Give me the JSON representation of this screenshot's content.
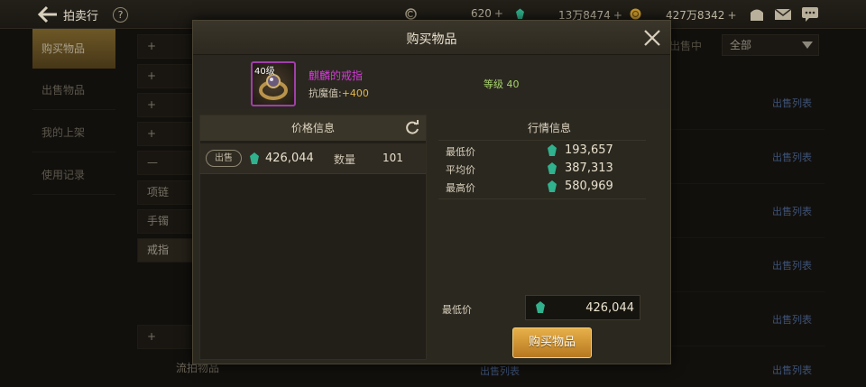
{
  "topbar": {
    "title": "拍卖行",
    "help_label": "?",
    "currency1": "620",
    "currency2": "13万8474",
    "currency3": "427万8342",
    "plus": "+"
  },
  "sidebar": {
    "items": [
      {
        "label": "购买物品"
      },
      {
        "label": "出售物品"
      },
      {
        "label": "我的上架"
      },
      {
        "label": "使用记录"
      }
    ]
  },
  "categories": {
    "rows": [
      {
        "label": "+"
      },
      {
        "label": "+"
      },
      {
        "label": "+"
      },
      {
        "label": "+"
      },
      {
        "label": "—"
      },
      {
        "label": "项链"
      },
      {
        "label": "手镯"
      },
      {
        "label": "戒指"
      },
      {
        "label": "+"
      }
    ]
  },
  "filter": {
    "label": "出售中",
    "selected": "全部"
  },
  "background_list": {
    "sell_list_label": "出售列表",
    "bottom_item": "流拍物品"
  },
  "modal": {
    "title": "购买物品",
    "item": {
      "level_badge": "40级",
      "name": "麒麟的戒指",
      "stat_label": "抗魔值:",
      "stat_value": "+400",
      "level_text": "等级 40"
    },
    "price_info": {
      "header": "价格信息",
      "row": {
        "tag": "出售",
        "price": "426,044",
        "qty_label": "数量",
        "qty": "101"
      }
    },
    "market_info": {
      "header": "行情信息",
      "lowest_label": "最低价",
      "lowest": "193,657",
      "average_label": "平均价",
      "average": "387,313",
      "highest_label": "最高价",
      "highest": "580,969"
    },
    "min_price_label": "最低价",
    "min_price_value": "426,044",
    "buy_button": "购买物品"
  },
  "colors": {
    "accent_gold": "#e7b04a",
    "item_name_purple": "#d23bd6",
    "level_green": "#a7d36b",
    "link_blue": "#5f7fb6"
  }
}
